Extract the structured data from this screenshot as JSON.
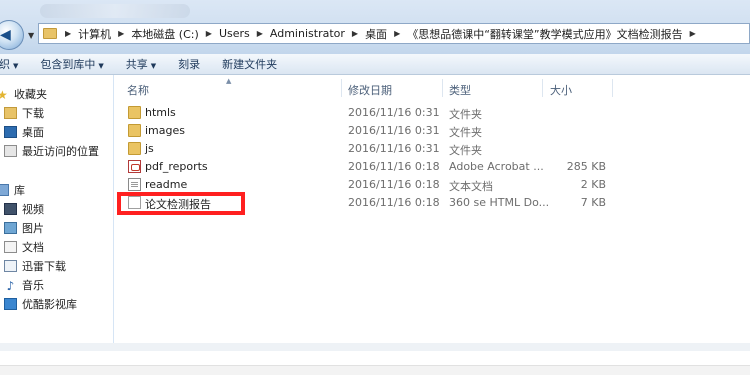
{
  "address": {
    "crumbs": [
      "计算机",
      "本地磁盘 (C:)",
      "Users",
      "Administrator",
      "桌面",
      "《思想品德课中“翻转课堂”教学模式应用》文档检测报告"
    ]
  },
  "toolbar": {
    "organize": "组织",
    "include_in_library": "包含到库中",
    "share": "共享",
    "burn": "刻录",
    "new_folder": "新建文件夹"
  },
  "nav": {
    "favorites": "收藏夹",
    "downloads": "下载",
    "desktop": "桌面",
    "recent": "最近访问的位置",
    "libraries": "库",
    "videos": "视频",
    "pictures": "图片",
    "documents": "文档",
    "thunder": "迅雷下载",
    "music": "音乐",
    "youku": "优酷影视库"
  },
  "columns": {
    "name": "名称",
    "date": "修改日期",
    "type": "类型",
    "size": "大小"
  },
  "files": [
    {
      "icon": "folder-icon",
      "name": "htmls",
      "date": "2016/11/16 0:31",
      "type": "文件夹",
      "size": ""
    },
    {
      "icon": "folder-icon",
      "name": "images",
      "date": "2016/11/16 0:31",
      "type": "文件夹",
      "size": ""
    },
    {
      "icon": "folder-icon",
      "name": "js",
      "date": "2016/11/16 0:31",
      "type": "文件夹",
      "size": ""
    },
    {
      "icon": "pdf-icon",
      "name": "pdf_reports",
      "date": "2016/11/16 0:18",
      "type": "Adobe Acrobat ...",
      "size": "285 KB"
    },
    {
      "icon": "text-file-icon",
      "name": "readme",
      "date": "2016/11/16 0:18",
      "type": "文本文档",
      "size": "2 KB"
    },
    {
      "icon": "html-file-icon",
      "name": "论文检测报告",
      "date": "2016/11/16 0:18",
      "type": "360 se HTML Do...",
      "size": "7 KB"
    }
  ],
  "colors": {
    "highlight": "#ff2020",
    "folder": "#eac463",
    "accent": "#1e395b"
  }
}
